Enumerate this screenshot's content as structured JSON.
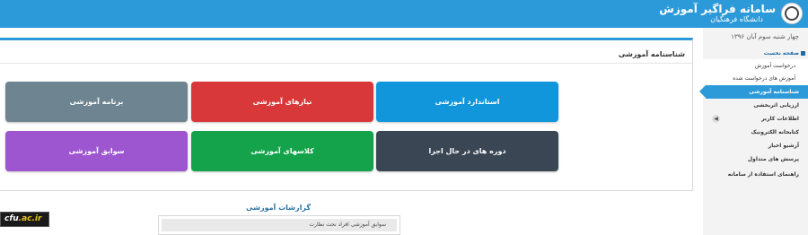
{
  "header": {
    "title": "سامانه فراگیر آموزش",
    "subtitle": "دانشگاه فرهنگیان",
    "color": "#2c9ad8"
  },
  "sidebar": {
    "date": "چهار شنبه سوم آبان ۱۳۹۶",
    "items": [
      {
        "label": "صفحه نخست"
      },
      {
        "label": "درخواست آموزش"
      },
      {
        "label": "آموزش های درخواست شده"
      },
      {
        "label": "شناسنامه آموزشی"
      },
      {
        "label": "ارزیابی اثربخشی"
      },
      {
        "label": "اطلاعات کاربر"
      },
      {
        "label": "کتابخانه الکترونیک"
      },
      {
        "label": "آرشیو اخبار"
      },
      {
        "label": "پرسش های متداول"
      },
      {
        "label": "راهنمای استفاده از سامانه"
      }
    ]
  },
  "panel": {
    "title": "شناسنامه آموزشی",
    "tiles": [
      {
        "label": "استاندارد آموزشی",
        "color": "#1296db"
      },
      {
        "label": "نیازهای آموزشی",
        "color": "#d9383a"
      },
      {
        "label": "برنامه آموزشی",
        "color": "#6e8591"
      },
      {
        "label": "دوره های در حال اجرا",
        "color": "#3a4654"
      },
      {
        "label": "کلاسهای آموزشی",
        "color": "#14a34a"
      },
      {
        "label": "سوابق آموزشی",
        "color": "#9d56cf"
      }
    ]
  },
  "reports": {
    "title": "گزارشات آموزشی",
    "rows": [
      {
        "label": "سوابق آموزشی افراد تحت نظارت"
      }
    ]
  },
  "watermark": {
    "text_main": "cfu",
    "text_accent": ".ac.ir"
  }
}
